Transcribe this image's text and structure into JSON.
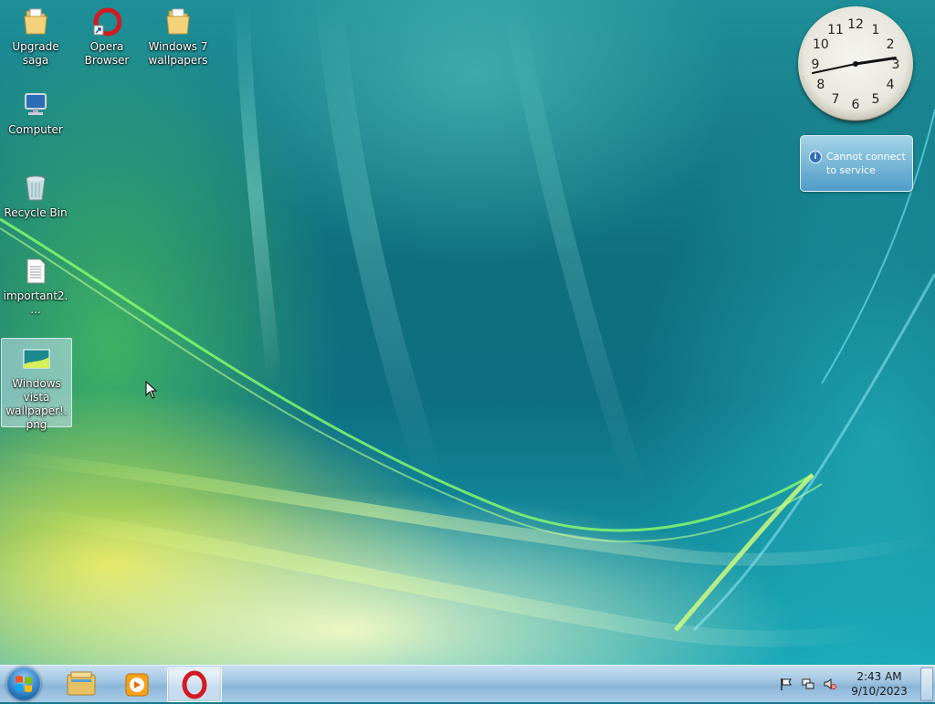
{
  "desktop": {
    "icons": [
      {
        "label": "Upgrade saga",
        "icon": "folder-icon"
      },
      {
        "label": "Opera Browser",
        "icon": "opera-shortcut-icon"
      },
      {
        "label": "Windows 7 wallpapers",
        "icon": "folder-icon"
      },
      {
        "label": "Computer",
        "icon": "computer-icon"
      },
      {
        "label": "Recycle Bin",
        "icon": "recycle-bin-icon"
      },
      {
        "label": "important2....",
        "icon": "text-file-icon"
      },
      {
        "label": "Windows vista wallpaper!.png",
        "icon": "image-file-icon"
      }
    ]
  },
  "gadgets": {
    "clock": {
      "numbers": [
        "12",
        "1",
        "2",
        "3",
        "4",
        "5",
        "6",
        "7",
        "8",
        "9",
        "10",
        "11"
      ],
      "hour": 2,
      "minute": 43
    },
    "weather": {
      "message": "Cannot connect to service",
      "icon": "info-icon"
    }
  },
  "taskbar": {
    "start_icon": "windows-logo-icon",
    "pinned": [
      {
        "name": "Windows Explorer",
        "icon": "explorer-icon"
      },
      {
        "name": "Windows Media Player",
        "icon": "media-player-icon"
      },
      {
        "name": "Opera",
        "icon": "opera-icon"
      }
    ],
    "tray": {
      "time": "2:43 AM",
      "date": "9/10/2023",
      "icons": [
        "action-center-flag-icon",
        "network-icon",
        "volume-muted-icon"
      ]
    }
  },
  "colors": {
    "taskbar": "#9fc3e0",
    "opera_red": "#d11b22",
    "selection": "#cfe3f1"
  }
}
